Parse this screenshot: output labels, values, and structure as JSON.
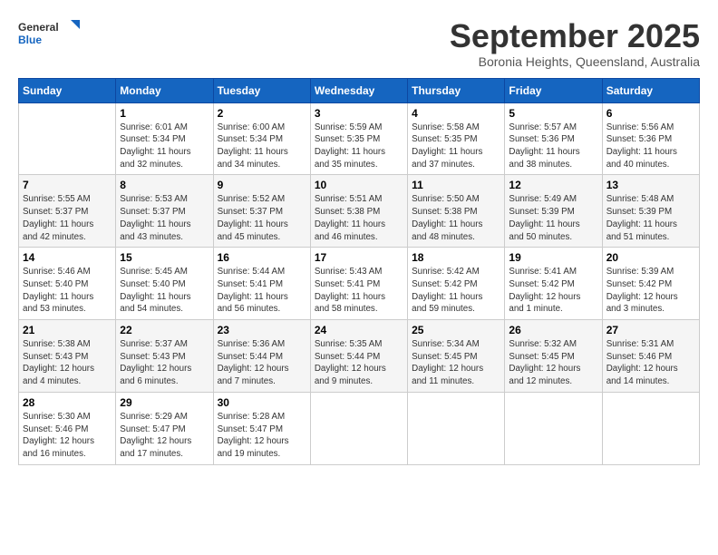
{
  "header": {
    "logo_general": "General",
    "logo_blue": "Blue",
    "month_title": "September 2025",
    "subtitle": "Boronia Heights, Queensland, Australia"
  },
  "days_of_week": [
    "Sunday",
    "Monday",
    "Tuesday",
    "Wednesday",
    "Thursday",
    "Friday",
    "Saturday"
  ],
  "weeks": [
    [
      {
        "date": "",
        "info": ""
      },
      {
        "date": "1",
        "info": "Sunrise: 6:01 AM\nSunset: 5:34 PM\nDaylight: 11 hours\nand 32 minutes."
      },
      {
        "date": "2",
        "info": "Sunrise: 6:00 AM\nSunset: 5:34 PM\nDaylight: 11 hours\nand 34 minutes."
      },
      {
        "date": "3",
        "info": "Sunrise: 5:59 AM\nSunset: 5:35 PM\nDaylight: 11 hours\nand 35 minutes."
      },
      {
        "date": "4",
        "info": "Sunrise: 5:58 AM\nSunset: 5:35 PM\nDaylight: 11 hours\nand 37 minutes."
      },
      {
        "date": "5",
        "info": "Sunrise: 5:57 AM\nSunset: 5:36 PM\nDaylight: 11 hours\nand 38 minutes."
      },
      {
        "date": "6",
        "info": "Sunrise: 5:56 AM\nSunset: 5:36 PM\nDaylight: 11 hours\nand 40 minutes."
      }
    ],
    [
      {
        "date": "7",
        "info": "Sunrise: 5:55 AM\nSunset: 5:37 PM\nDaylight: 11 hours\nand 42 minutes."
      },
      {
        "date": "8",
        "info": "Sunrise: 5:53 AM\nSunset: 5:37 PM\nDaylight: 11 hours\nand 43 minutes."
      },
      {
        "date": "9",
        "info": "Sunrise: 5:52 AM\nSunset: 5:37 PM\nDaylight: 11 hours\nand 45 minutes."
      },
      {
        "date": "10",
        "info": "Sunrise: 5:51 AM\nSunset: 5:38 PM\nDaylight: 11 hours\nand 46 minutes."
      },
      {
        "date": "11",
        "info": "Sunrise: 5:50 AM\nSunset: 5:38 PM\nDaylight: 11 hours\nand 48 minutes."
      },
      {
        "date": "12",
        "info": "Sunrise: 5:49 AM\nSunset: 5:39 PM\nDaylight: 11 hours\nand 50 minutes."
      },
      {
        "date": "13",
        "info": "Sunrise: 5:48 AM\nSunset: 5:39 PM\nDaylight: 11 hours\nand 51 minutes."
      }
    ],
    [
      {
        "date": "14",
        "info": "Sunrise: 5:46 AM\nSunset: 5:40 PM\nDaylight: 11 hours\nand 53 minutes."
      },
      {
        "date": "15",
        "info": "Sunrise: 5:45 AM\nSunset: 5:40 PM\nDaylight: 11 hours\nand 54 minutes."
      },
      {
        "date": "16",
        "info": "Sunrise: 5:44 AM\nSunset: 5:41 PM\nDaylight: 11 hours\nand 56 minutes."
      },
      {
        "date": "17",
        "info": "Sunrise: 5:43 AM\nSunset: 5:41 PM\nDaylight: 11 hours\nand 58 minutes."
      },
      {
        "date": "18",
        "info": "Sunrise: 5:42 AM\nSunset: 5:42 PM\nDaylight: 11 hours\nand 59 minutes."
      },
      {
        "date": "19",
        "info": "Sunrise: 5:41 AM\nSunset: 5:42 PM\nDaylight: 12 hours\nand 1 minute."
      },
      {
        "date": "20",
        "info": "Sunrise: 5:39 AM\nSunset: 5:42 PM\nDaylight: 12 hours\nand 3 minutes."
      }
    ],
    [
      {
        "date": "21",
        "info": "Sunrise: 5:38 AM\nSunset: 5:43 PM\nDaylight: 12 hours\nand 4 minutes."
      },
      {
        "date": "22",
        "info": "Sunrise: 5:37 AM\nSunset: 5:43 PM\nDaylight: 12 hours\nand 6 minutes."
      },
      {
        "date": "23",
        "info": "Sunrise: 5:36 AM\nSunset: 5:44 PM\nDaylight: 12 hours\nand 7 minutes."
      },
      {
        "date": "24",
        "info": "Sunrise: 5:35 AM\nSunset: 5:44 PM\nDaylight: 12 hours\nand 9 minutes."
      },
      {
        "date": "25",
        "info": "Sunrise: 5:34 AM\nSunset: 5:45 PM\nDaylight: 12 hours\nand 11 minutes."
      },
      {
        "date": "26",
        "info": "Sunrise: 5:32 AM\nSunset: 5:45 PM\nDaylight: 12 hours\nand 12 minutes."
      },
      {
        "date": "27",
        "info": "Sunrise: 5:31 AM\nSunset: 5:46 PM\nDaylight: 12 hours\nand 14 minutes."
      }
    ],
    [
      {
        "date": "28",
        "info": "Sunrise: 5:30 AM\nSunset: 5:46 PM\nDaylight: 12 hours\nand 16 minutes."
      },
      {
        "date": "29",
        "info": "Sunrise: 5:29 AM\nSunset: 5:47 PM\nDaylight: 12 hours\nand 17 minutes."
      },
      {
        "date": "30",
        "info": "Sunrise: 5:28 AM\nSunset: 5:47 PM\nDaylight: 12 hours\nand 19 minutes."
      },
      {
        "date": "",
        "info": ""
      },
      {
        "date": "",
        "info": ""
      },
      {
        "date": "",
        "info": ""
      },
      {
        "date": "",
        "info": ""
      }
    ]
  ]
}
